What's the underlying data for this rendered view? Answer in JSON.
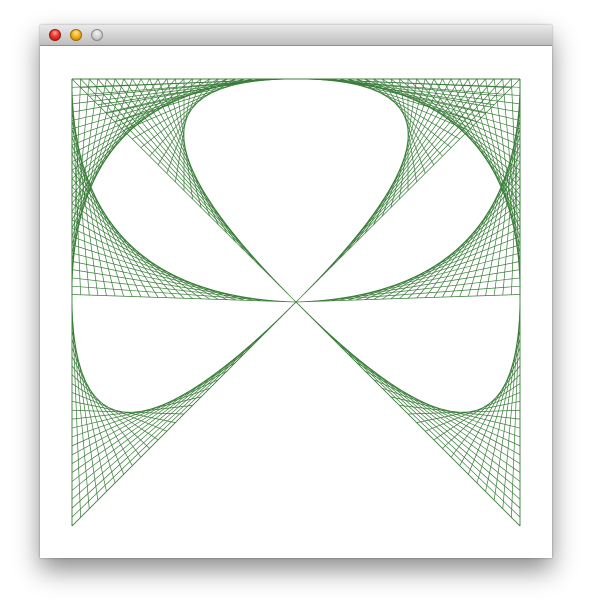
{
  "window": {
    "title": "",
    "buttons": [
      {
        "name": "close-button",
        "color": "#e8362b"
      },
      {
        "name": "minimize-button",
        "color": "#f6b11e"
      },
      {
        "name": "zoom-button",
        "color": "#bdbdbd"
      }
    ]
  },
  "drawing": {
    "stroke_color": "#3a7d3a",
    "background_color": "#ffffff"
  }
}
